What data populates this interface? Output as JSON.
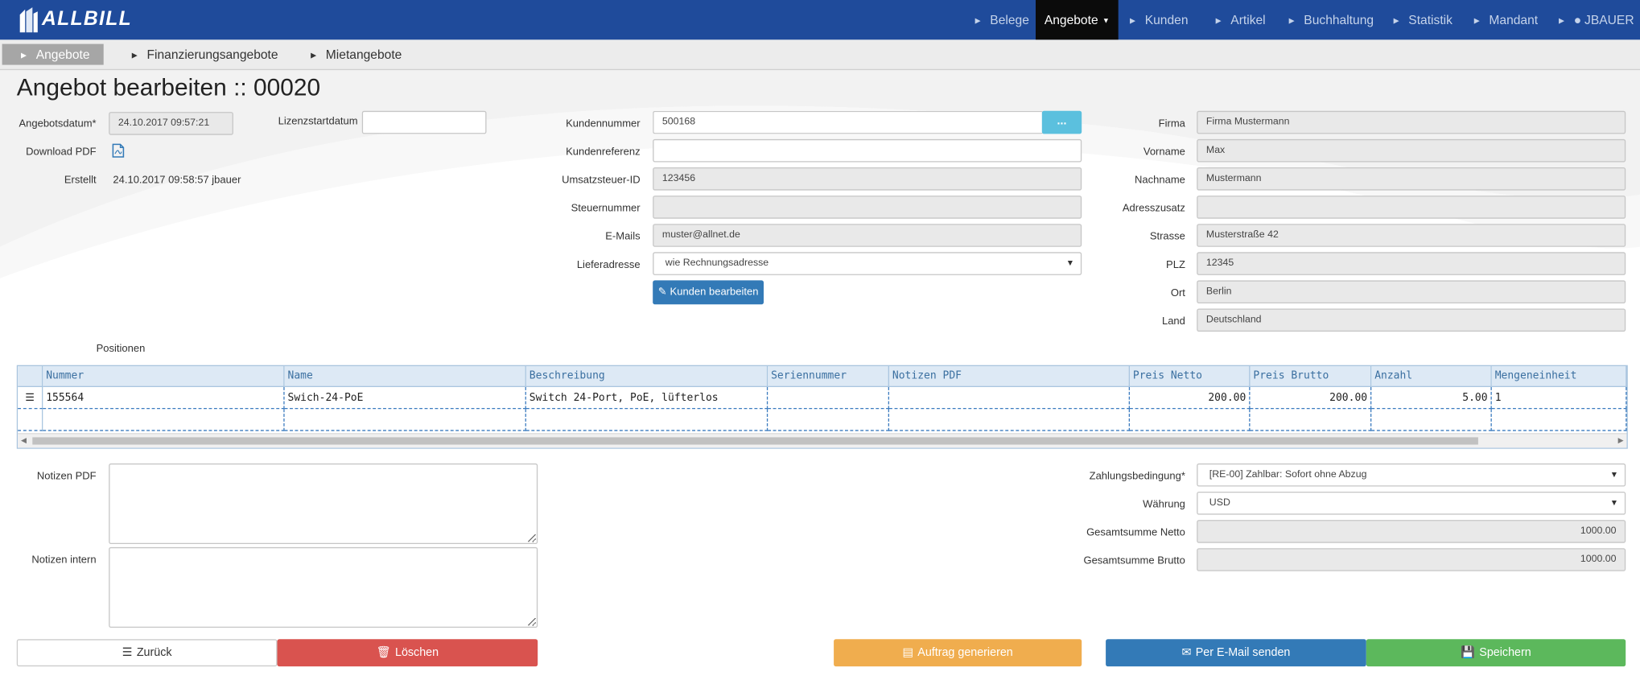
{
  "nav": {
    "brand": "ALLBILL",
    "items": [
      "Belege",
      "Angebote",
      "Kunden",
      "Artikel",
      "Buchhaltung",
      "Statistik",
      "Mandant",
      "JBAUER"
    ]
  },
  "subnav": [
    "Angebote",
    "Finanzierungsangebote",
    "Mietangebote"
  ],
  "page_title": "Angebot bearbeiten :: 00020",
  "meta": {
    "angebotsdatum_label": "Angebotsdatum*",
    "angebotsdatum_value": "24.10.2017 09:57:21",
    "lizenz_label": "Lizenzstartdatum",
    "lizenz_value": "",
    "download_label": "Download PDF",
    "erstellt_label": "Erstellt",
    "erstellt_value": "24.10.2017 09:58:57 jbauer"
  },
  "customer": {
    "kundennummer_label": "Kundennummer",
    "kundennummer": "500168",
    "picker_label": "...",
    "kundenreferenz_label": "Kundenreferenz",
    "kundenreferenz": "",
    "ust_label": "Umsatzsteuer-ID",
    "ust": "123456",
    "steuer_label": "Steuernummer",
    "steuer": "",
    "email_label": "E-Mails",
    "email": "muster@allnet.de",
    "liefer_label": "Lieferadresse",
    "liefer": "wie Rechnungsadresse",
    "edit_button": "Kunden bearbeiten"
  },
  "address": {
    "firma_label": "Firma",
    "firma": "Firma Mustermann",
    "vorname_label": "Vorname",
    "vorname": "Max",
    "nachname_label": "Nachname",
    "nachname": "Mustermann",
    "zusatz_label": "Adresszusatz",
    "zusatz": "",
    "strasse_label": "Strasse",
    "strasse": "Musterstraße 42",
    "plz_label": "PLZ",
    "plz": "12345",
    "ort_label": "Ort",
    "ort": "Berlin",
    "land_label": "Land",
    "land": "Deutschland"
  },
  "positions": {
    "label": "Positionen",
    "columns": [
      "Nummer",
      "Name",
      "Beschreibung",
      "Seriennummer",
      "Notizen PDF",
      "Preis Netto",
      "Preis Brutto",
      "Anzahl",
      "Mengeneinheit"
    ],
    "rows": [
      [
        "155564",
        "Swich-24-PoE",
        "Switch 24-Port, PoE, lüfterlos",
        "",
        "",
        "200.00",
        "200.00",
        "5.00",
        "1"
      ]
    ]
  },
  "notes": {
    "pdf_label": "Notizen PDF",
    "intern_label": "Notizen intern"
  },
  "payment": {
    "zahlung_label": "Zahlungsbedingung*",
    "zahlung": "[RE-00] Zahlbar: Sofort ohne Abzug",
    "waehrung_label": "Währung",
    "waehrung": "USD",
    "netto_label": "Gesamtsumme Netto",
    "netto": "1000.00",
    "brutto_label": "Gesamtsumme Brutto",
    "brutto": "1000.00"
  },
  "actions": {
    "back": "Zurück",
    "delete": "Löschen",
    "order": "Auftrag generieren",
    "email": "Per E-Mail senden",
    "save": "Speichern"
  },
  "colors": {
    "navbar": "#1f4b9b",
    "primary": "#337ab7",
    "danger": "#d9534f",
    "warning": "#f0ad4e",
    "success": "#5cb85c",
    "info": "#5bc0de"
  }
}
